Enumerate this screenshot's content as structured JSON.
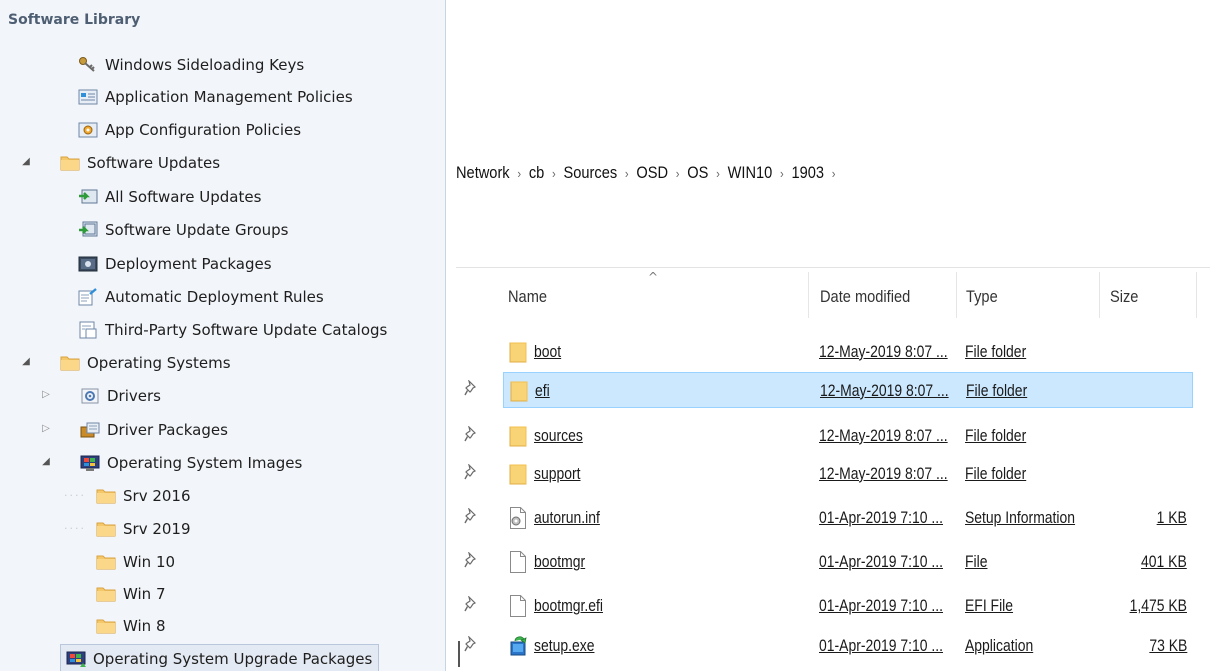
{
  "tree": {
    "title": "Software Library",
    "items": [
      {
        "label": "Windows Sideloading Keys",
        "icon": "key-icon"
      },
      {
        "label": "Application Management Policies",
        "icon": "policy-icon"
      },
      {
        "label": "App Configuration Policies",
        "icon": "config-policy-icon"
      },
      {
        "label": "Software Updates",
        "icon": "folder-icon",
        "expanded": true
      },
      {
        "label": "All Software Updates",
        "icon": "updates-icon"
      },
      {
        "label": "Software Update Groups",
        "icon": "update-groups-icon"
      },
      {
        "label": "Deployment Packages",
        "icon": "package-icon"
      },
      {
        "label": "Automatic Deployment Rules",
        "icon": "rules-icon"
      },
      {
        "label": "Third-Party Software Update Catalogs",
        "icon": "catalog-icon"
      },
      {
        "label": "Operating Systems",
        "icon": "folder-icon",
        "expanded": true
      },
      {
        "label": "Drivers",
        "icon": "drivers-icon",
        "expanded": false
      },
      {
        "label": "Driver Packages",
        "icon": "driver-packages-icon",
        "expanded": false
      },
      {
        "label": "Operating System Images",
        "icon": "os-images-icon",
        "expanded": true
      },
      {
        "label": "Srv 2016",
        "icon": "folder-icon"
      },
      {
        "label": "Srv 2019",
        "icon": "folder-icon"
      },
      {
        "label": "Win 10",
        "icon": "folder-icon"
      },
      {
        "label": "Win 7",
        "icon": "folder-icon"
      },
      {
        "label": "Win 8",
        "icon": "folder-icon"
      },
      {
        "label": "Operating System Upgrade Packages",
        "icon": "upgrade-packages-icon",
        "selected": true
      }
    ]
  },
  "breadcrumb": [
    "Network",
    "cb",
    "Sources",
    "OSD",
    "OS",
    "WIN10",
    "1903"
  ],
  "breadcrumb_separator": "›",
  "columns": {
    "name": "Name",
    "date": "Date modified",
    "type": "Type",
    "size": "Size",
    "sort_indicator": "^"
  },
  "files": [
    {
      "name": "boot",
      "date": "12-May-2019 8:07 ...",
      "type": "File folder",
      "size": "",
      "icon": "folder-icon"
    },
    {
      "name": "efi",
      "date": "12-May-2019 8:07 ...",
      "type": "File folder",
      "size": "",
      "icon": "folder-icon",
      "selected": true
    },
    {
      "name": "sources",
      "date": "12-May-2019 8:07 ...",
      "type": "File folder",
      "size": "",
      "icon": "folder-icon"
    },
    {
      "name": "support",
      "date": "12-May-2019 8:07 ...",
      "type": "File folder",
      "size": "",
      "icon": "folder-icon"
    },
    {
      "name": "autorun.inf",
      "date": "01-Apr-2019 7:10 ...",
      "type": "Setup Information",
      "size": "1 KB",
      "icon": "setup-info-file-icon"
    },
    {
      "name": "bootmgr",
      "date": "01-Apr-2019 7:10 ...",
      "type": "File",
      "size": "401 KB",
      "icon": "blank-file-icon"
    },
    {
      "name": "bootmgr.efi",
      "date": "01-Apr-2019 7:10 ...",
      "type": "EFI File",
      "size": "1,475 KB",
      "icon": "blank-file-icon"
    },
    {
      "name": "setup.exe",
      "date": "01-Apr-2019 7:10 ...",
      "type": "Application",
      "size": "73 KB",
      "icon": "setup-exe-icon"
    }
  ],
  "pin_glyph": "📌",
  "colors": {
    "selection_bg": "#cce8ff",
    "selection_border": "#99d1ff",
    "folder": "#f5c86a",
    "tree_bg": "#f2f5f9"
  }
}
